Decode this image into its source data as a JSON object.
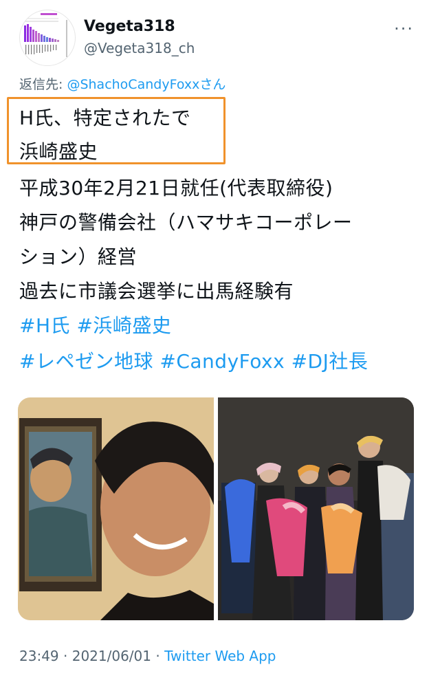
{
  "author": {
    "name": "Vegeta318",
    "handle": "@Vegeta318_ch",
    "avatar_icon": "bar-chart-avatar-icon"
  },
  "more_icon": "more-dots-icon",
  "reply": {
    "prefix": "返信先: ",
    "mention": "@ShachoCandyFoxx",
    "suffix": "さん"
  },
  "tweet": {
    "lines": [
      "H氏、特定されたで",
      "浜崎盛史",
      "平成30年2月21日就任(代表取締役)",
      "神戸の警備会社（ハマサキコーポレー",
      "ション）経営",
      "過去に市議会選挙に出馬経験有"
    ],
    "hashtags": [
      "#H氏",
      "#浜崎盛史",
      "#レペゼン地球",
      "#CandyFoxx",
      "#DJ社長"
    ]
  },
  "meta": {
    "time": "23:49",
    "sep1": " · ",
    "date": "2021/06/01",
    "sep2": " · ",
    "app": "Twitter Web App"
  },
  "colors": {
    "accent": "#1d9bf0",
    "highlight_box": "#f0922b",
    "secondary": "#536471"
  }
}
